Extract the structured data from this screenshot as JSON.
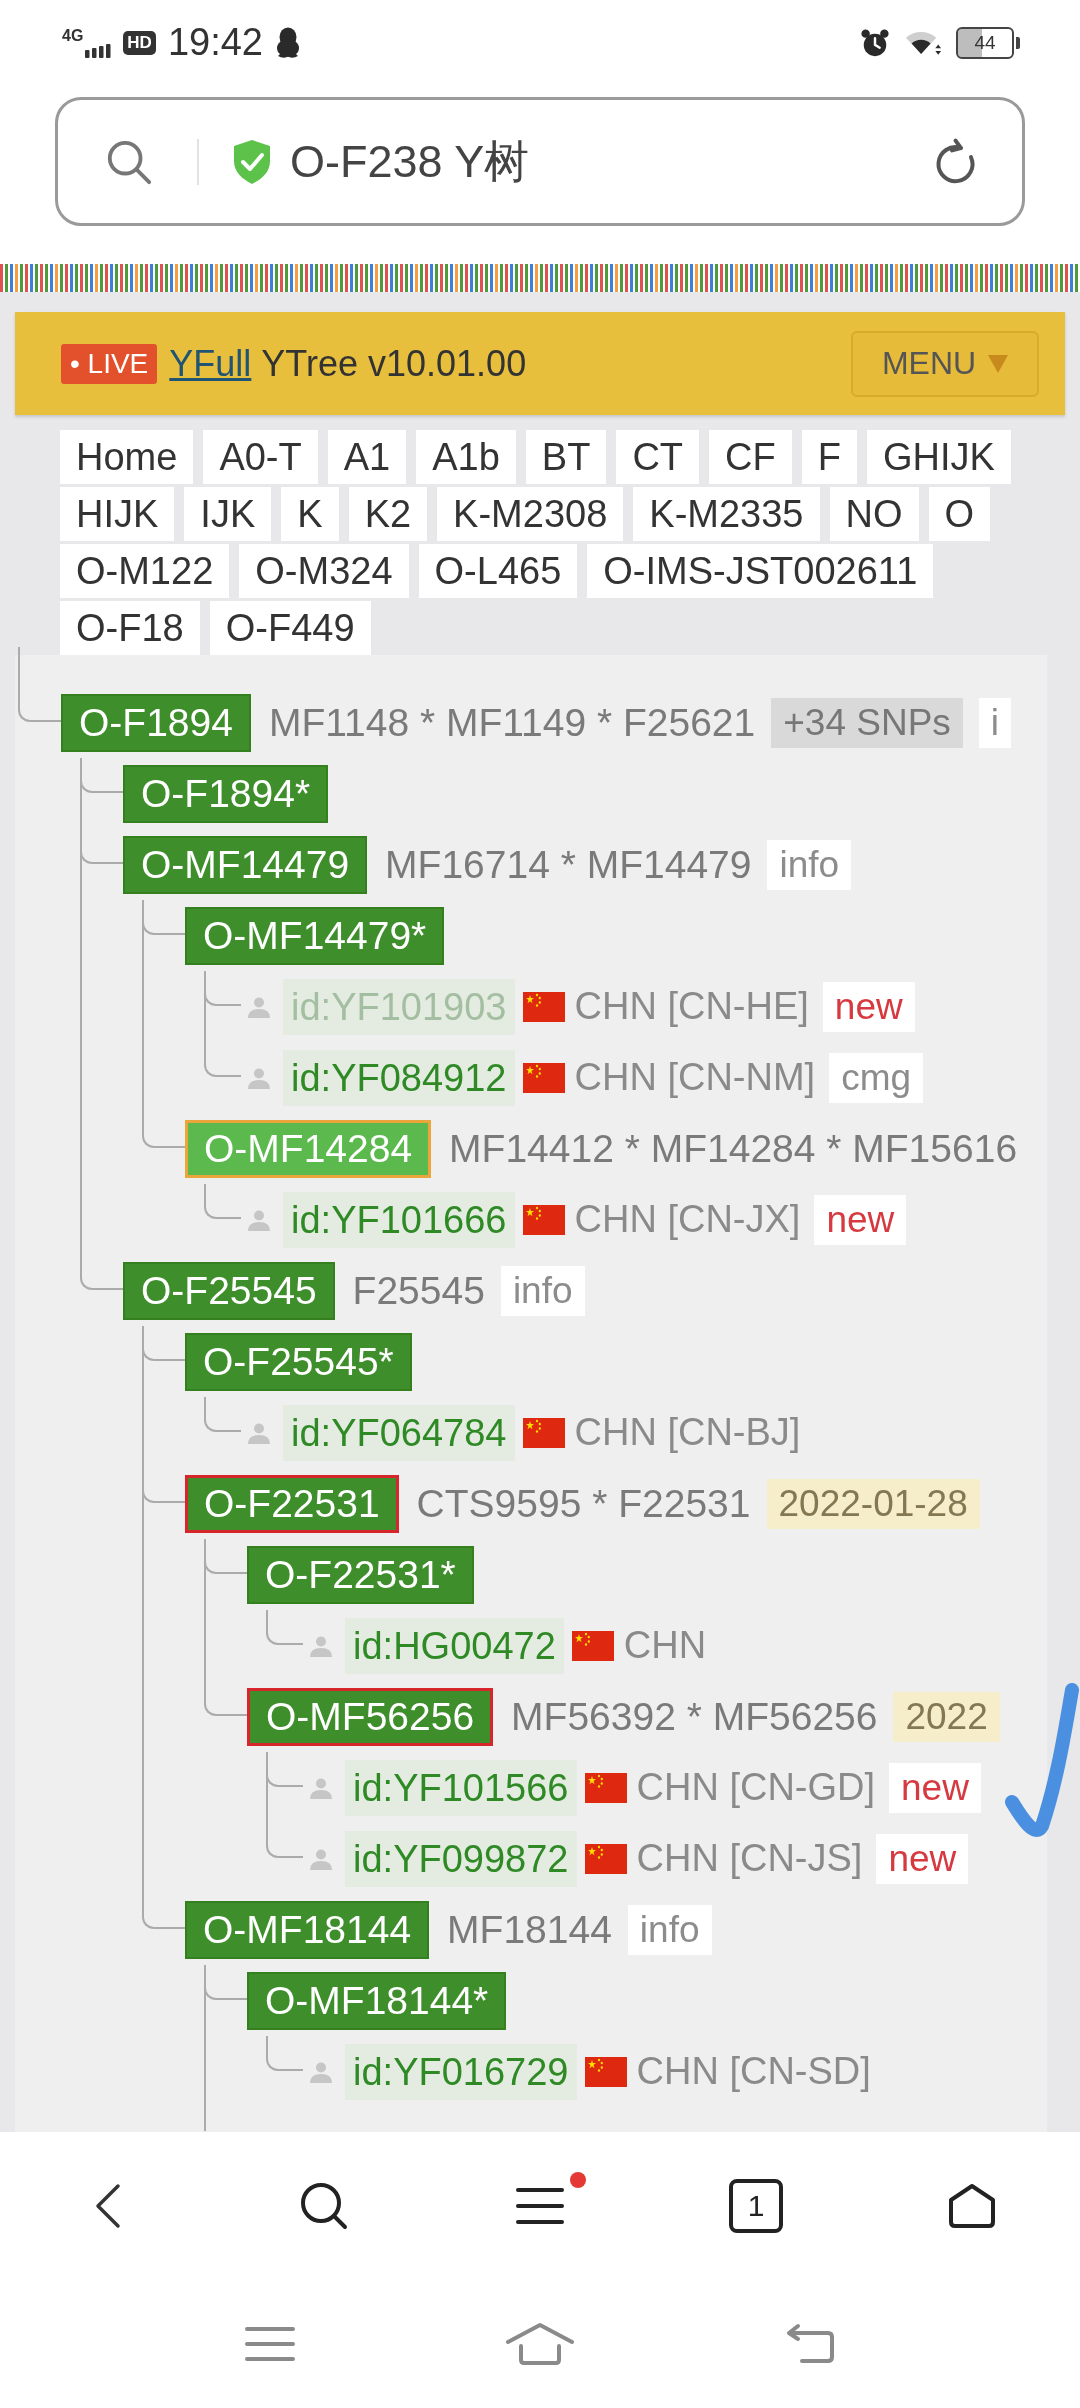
{
  "status_bar": {
    "network": "4G",
    "hd": "HD",
    "time": "19:42",
    "battery": "44"
  },
  "address_bar": {
    "secure": true,
    "value": "O-F238 Y树"
  },
  "header": {
    "live_badge": "• LIVE",
    "link": "YFull",
    "title": "YTree v10.01.00",
    "menu_button": "MENU"
  },
  "nav_tabs": [
    "Home",
    "A0-T",
    "A1",
    "A1b",
    "BT",
    "CT",
    "CF",
    "F",
    "GHIJK",
    "HIJK",
    "IJK",
    "K",
    "K2",
    "K-M2308",
    "K-M2335",
    "NO",
    "O",
    "O-M122",
    "O-M324",
    "O-L465",
    "O-IMS-JST002611",
    "O-F18",
    "O-F449"
  ],
  "tree": [
    {
      "kind": "haplogroup",
      "label": "O-F1894",
      "highlighted": false,
      "snps": "MF1148 * MF1149 * F25621",
      "tags": [
        {
          "kind": "count",
          "text": "+34 SNPs"
        },
        {
          "kind": "info",
          "text": "i"
        }
      ],
      "children": [
        {
          "kind": "haplogroup",
          "label": "O-F1894*",
          "highlighted": false
        },
        {
          "kind": "haplogroup",
          "label": "O-MF14479",
          "highlighted": false,
          "snps": "MF16714 * MF14479",
          "tags": [
            {
              "kind": "info",
              "text": "info"
            }
          ],
          "children": [
            {
              "kind": "haplogroup",
              "label": "O-MF14479*",
              "highlighted": false,
              "children": [
                {
                  "kind": "sample",
                  "id": "id:YF101903",
                  "dimmed": true,
                  "country": "CHN [CN-HE]",
                  "tag": {
                    "kind": "new",
                    "text": "new"
                  }
                },
                {
                  "kind": "sample",
                  "id": "id:YF084912",
                  "dimmed": false,
                  "country": "CHN [CN-NM]",
                  "tag": {
                    "kind": "note",
                    "text": "cmg"
                  }
                }
              ]
            },
            {
              "kind": "haplogroup",
              "label": "O-MF14284",
              "highlighted": true,
              "color": "#eaa63a",
              "snps": "MF14412 * MF14284 * MF15616",
              "children": [
                {
                  "kind": "sample",
                  "id": "id:YF101666",
                  "dimmed": false,
                  "country": "CHN [CN-JX]",
                  "tag": {
                    "kind": "new",
                    "text": "new"
                  }
                }
              ]
            }
          ]
        },
        {
          "kind": "haplogroup",
          "label": "O-F25545",
          "highlighted": false,
          "snps": "F25545",
          "tags": [
            {
              "kind": "info",
              "text": "info"
            }
          ],
          "children": [
            {
              "kind": "haplogroup",
              "label": "O-F25545*",
              "highlighted": false,
              "children": [
                {
                  "kind": "sample",
                  "id": "id:YF064784",
                  "dimmed": false,
                  "country": "CHN [CN-BJ]"
                }
              ]
            },
            {
              "kind": "haplogroup",
              "label": "O-F22531",
              "highlighted": false,
              "color": "#d6262b",
              "snps": "CTS9595 * F22531",
              "tags": [
                {
                  "kind": "date",
                  "text": "2022-01-28"
                }
              ],
              "children": [
                {
                  "kind": "haplogroup",
                  "label": "O-F22531*",
                  "highlighted": false,
                  "children": [
                    {
                      "kind": "sample",
                      "id": "id:HG00472",
                      "dimmed": false,
                      "country": "CHN"
                    }
                  ]
                },
                {
                  "kind": "haplogroup",
                  "label": "O-MF56256",
                  "highlighted": false,
                  "color": "#d6262b",
                  "snps": "MF56392 * MF56256",
                  "tags": [
                    {
                      "kind": "date",
                      "text": "2022"
                    }
                  ],
                  "children": [
                    {
                      "kind": "sample",
                      "id": "id:YF101566",
                      "dimmed": false,
                      "country": "CHN [CN-GD]",
                      "tag": {
                        "kind": "new",
                        "text": "new"
                      }
                    },
                    {
                      "kind": "sample",
                      "id": "id:YF099872",
                      "dimmed": false,
                      "country": "CHN [CN-JS]",
                      "tag": {
                        "kind": "new",
                        "text": "new"
                      }
                    }
                  ]
                }
              ]
            },
            {
              "kind": "haplogroup",
              "label": "O-MF18144",
              "highlighted": false,
              "snps": "MF18144",
              "tags": [
                {
                  "kind": "info",
                  "text": "info"
                }
              ],
              "continues_below": true,
              "children": [
                {
                  "kind": "haplogroup",
                  "label": "O-MF18144*",
                  "highlighted": false,
                  "children": [
                    {
                      "kind": "sample",
                      "id": "id:YF016729",
                      "dimmed": false,
                      "country": "CHN [CN-SD]"
                    }
                  ]
                }
              ]
            }
          ]
        }
      ]
    }
  ],
  "browser_toolbar": {
    "tab_count": "1",
    "menu_badge": true
  }
}
